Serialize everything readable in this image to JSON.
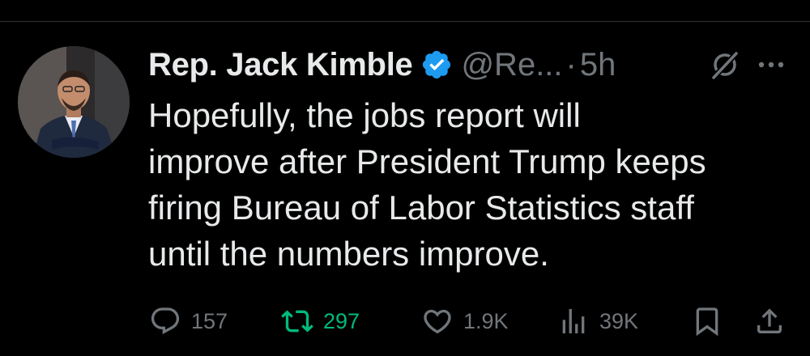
{
  "author": {
    "name": "Rep. Jack Kimble",
    "handle": "@Re...",
    "time": "5h"
  },
  "separator": "·",
  "tweet": {
    "lines": [
      "Hopefully, the jobs report will",
      "improve after President Trump keeps",
      "firing Bureau of Labor Statistics staff",
      "until the numbers improve."
    ]
  },
  "actions": {
    "replies": "157",
    "reposts": "297",
    "likes": "1.9K",
    "views": "39K"
  },
  "colors": {
    "background": "#000000",
    "text": "#e7e9ea",
    "muted": "#71767b",
    "verified": "#1d9bf0",
    "repost_active": "#00ba7c"
  },
  "icons": [
    "verified-badge-icon",
    "grok-icon",
    "more-icon",
    "reply-icon",
    "repost-icon",
    "like-icon",
    "views-icon",
    "bookmark-icon",
    "share-icon"
  ]
}
